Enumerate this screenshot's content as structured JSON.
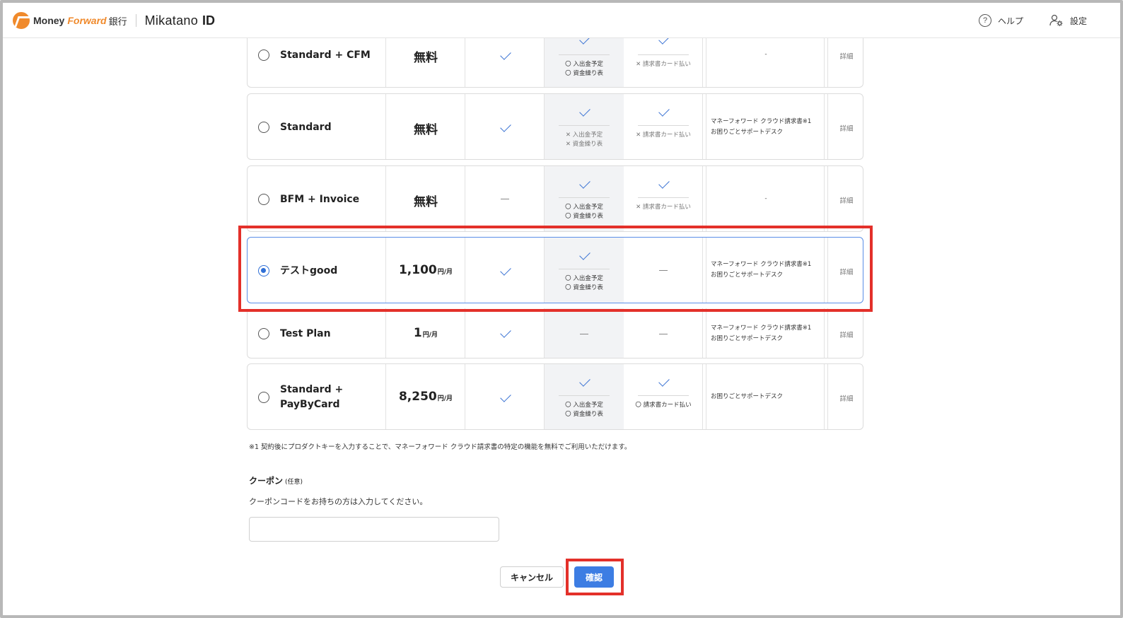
{
  "header": {
    "logo_money": "Money",
    "logo_forward": "Forward",
    "logo_bank": "銀行",
    "logo_mikatano": "Mikatano",
    "logo_id": "ID",
    "help_label": "ヘルプ",
    "settings_label": "設定"
  },
  "plans": [
    {
      "name": "Standard + CFM",
      "price": "無料",
      "unit": "",
      "feat1_a": "〇 入出金予定",
      "feat1_b": "〇 資金繰り表",
      "feat2": "✕ 請求書カード払い",
      "support": "-",
      "detail": "詳細"
    },
    {
      "name": "Standard",
      "price": "無料",
      "unit": "",
      "feat1_a": "✕ 入出金予定",
      "feat1_b": "✕ 資金繰り表",
      "feat2": "✕ 請求書カード払い",
      "support_a": "マネーフォワード クラウド請求書※1",
      "support_b": "お困りごとサポートデスク",
      "detail": "詳細"
    },
    {
      "name": "BFM + Invoice",
      "price": "無料",
      "unit": "",
      "feat1_a": "〇 入出金予定",
      "feat1_b": "〇 資金繰り表",
      "feat2": "✕ 請求書カード払い",
      "support": "-",
      "detail": "詳細"
    },
    {
      "name": "テストgood",
      "price": "1,100",
      "unit": "円/月",
      "feat1_a": "〇 入出金予定",
      "feat1_b": "〇 資金繰り表",
      "support_a": "マネーフォワード クラウド請求書※1",
      "support_b": "お困りごとサポートデスク",
      "detail": "詳細"
    },
    {
      "name": "Test Plan",
      "price": "1",
      "unit": "円/月",
      "support_a": "マネーフォワード クラウド請求書※1",
      "support_b": "お困りごとサポートデスク",
      "detail": "詳細"
    },
    {
      "name_a": "Standard +",
      "name_b": "PayByCard",
      "price": "8,250",
      "unit": "円/月",
      "feat1_a": "〇 入出金予定",
      "feat1_b": "〇 資金繰り表",
      "feat2": "〇 請求書カード払い",
      "support": "お困りごとサポートデスク",
      "detail": "詳細"
    }
  ],
  "selected_plan": "テストgood",
  "footnote": "※1 契約後にプロダクトキーを入力することで、マネーフォワード クラウド請求書の特定の機能を無料でご利用いただけます。",
  "coupon": {
    "title": "クーポン",
    "optional": "(任意)",
    "description": "クーポンコードをお持ちの方は入力してください。",
    "value": ""
  },
  "buttons": {
    "cancel": "キャンセル",
    "confirm": "確認"
  },
  "colors": {
    "accent": "#3d7de3",
    "brand": "#f08a2c",
    "highlight": "#e3302a"
  }
}
